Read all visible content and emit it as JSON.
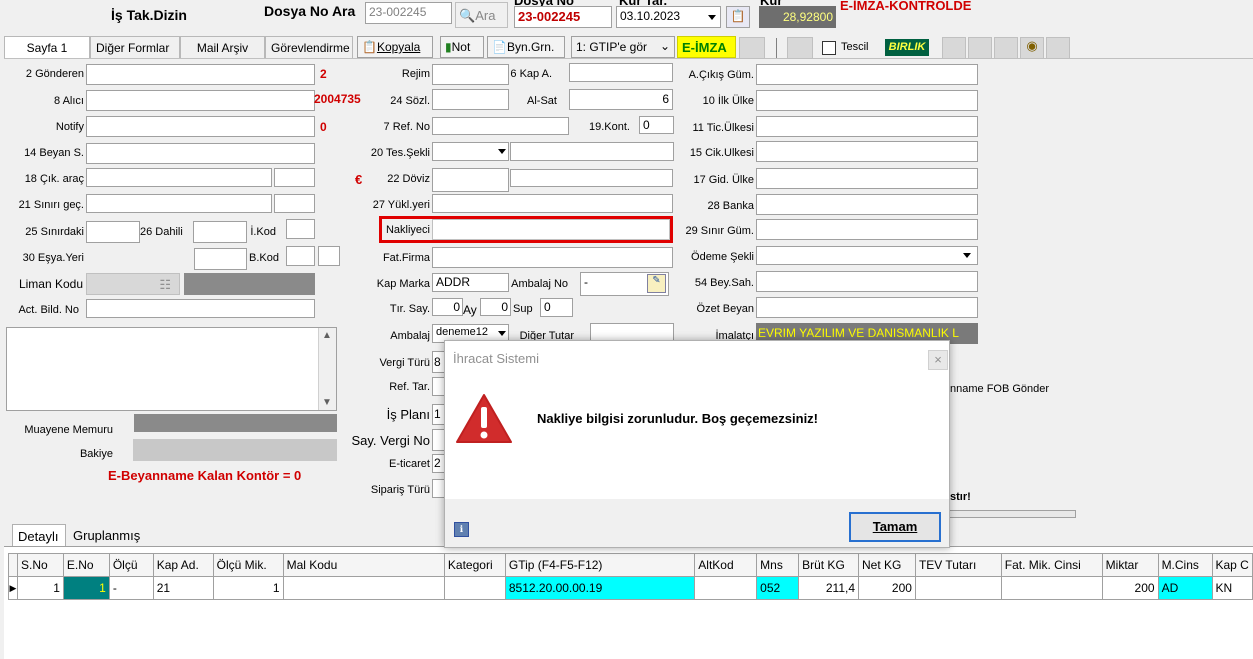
{
  "header": {
    "title": "İş Tak.Dizin",
    "dosya_no_label": "Dosya No Ara",
    "search_value": "23-002245",
    "ara_label": "Ara",
    "dosya_no_top": "Dosya No",
    "dosya_no_value": "23-002245",
    "kur_tar_label": "Kur Tar.",
    "date_value": "03.10.2023",
    "kur_label": "Kur",
    "kur_value": "28,92800",
    "status": "E-İMZA-KONTROLDE"
  },
  "tabs": [
    "Sayfa 1",
    "Diğer Formlar",
    "Mail Arşiv",
    "Görevlendirme"
  ],
  "toolbar": {
    "kopyala": "Kopyala",
    "not": "Not",
    "byn_grn": "Byn.Grn.",
    "gtip_select": "1: GTIP'e gör",
    "eimza": "E-İMZA",
    "tescil": "Tescil",
    "birlik": "BIRLIK"
  },
  "left": {
    "gonderen": "2 Gönderen",
    "gonderen_no": "2",
    "alici": "8 Alıcı",
    "alici_no": "2004735",
    "notify": "Notify",
    "notify_no": "0",
    "beyan": "14 Beyan S.",
    "cik_arac": "18 Çık. araç",
    "euro": "€",
    "sinir_gec": "21 Sınırı geç.",
    "sinirdaki": "25 Sınırdaki",
    "dahili": "26 Dahili",
    "ikod": "İ.Kod",
    "esya_yeri": "30 Eşya.Yeri",
    "bkod": "B.Kod",
    "liman_kodu": "Liman Kodu",
    "act_bild": "Act. Bild. No",
    "muayene": "Muayene Memuru",
    "bakiye": "Bakiye",
    "kontor": "E-Beyanname Kalan Kontör = 0"
  },
  "middle": {
    "rejim": "Rejim",
    "kap_a": "6 Kap A.",
    "sozl": "24 Sözl.",
    "alsat": "Al-Sat",
    "alsat_val": "6",
    "ref_no": "7 Ref. No",
    "kont": "19.Kont.",
    "kont_val": "0",
    "tes_sekli": "20 Tes.Şekli",
    "doviz": "22 Döviz",
    "yukl_yeri": "27 Yükl.yeri",
    "nakliyeci": "Nakliyeci",
    "fat_firma": "Fat.Firma",
    "kap_marka": "Kap Marka",
    "kap_marka_val": "ADDR",
    "ambalaj_no": "Ambalaj No",
    "ambalaj_no_val": "-",
    "tir_say": "Tır. Say.",
    "tir_val": "0",
    "ay": "Ay",
    "ay_val": "0",
    "sup": "Sup",
    "sup_val": "0",
    "ambalaj": "Ambalaj",
    "ambalaj_val": "deneme12",
    "diger_tutar": "Diğer Tutar",
    "vergi_turu": "Vergi Türü",
    "vergi_val": "8",
    "ref_tar": "Ref. Tar.",
    "is_plani": "İş Planı",
    "is_plani_val": "1",
    "say_vergi": "Say. Vergi No",
    "eticaret": "E-ticaret",
    "eticaret_val": "2",
    "siparis": "Sipariş Türü"
  },
  "right": {
    "a_cikis": "A.Çıkış Güm.",
    "ilk_ulke": "10 İlk Ülke",
    "tic_ulkesi": "11 Tic.Ülkesi",
    "cik_ulkesi": "15 Cik.Ulkesi",
    "gid_ulke": "17 Gid. Ülke",
    "banka": "28 Banka",
    "sinir_gum": "29 Sınır Güm.",
    "odeme": "Ödeme Şekli",
    "bey_sah": "54 Bey.Sah.",
    "ozet": "Özet Beyan",
    "imalatci": "İmalatçı",
    "imalatci_val": "EVRIM YAZILIM VE DANISMANLIK L",
    "fob": "nname FOB Gönder",
    "stir": "stır!"
  },
  "dialog": {
    "title": "İhracat Sistemi",
    "message": "Nakliye bilgisi zorunludur. Boş geçemezsiniz!",
    "ok": "Tamam",
    "close": "×"
  },
  "bottom_tabs": [
    "Detaylı",
    "Gruplanmış"
  ],
  "grid": {
    "columns": [
      "S.No",
      "E.No",
      "Ölçü",
      "Kap Ad.",
      "Ölçü Mik.",
      "Mal Kodu",
      "Kategori",
      "GTip (F4-F5-F12)",
      "AltKod",
      "Mns",
      "Brüt KG",
      "Net KG",
      "TEV Tutarı",
      "Fat. Mik. Cinsi",
      "Miktar",
      "M.Cins",
      "Kap C"
    ],
    "row": [
      "1",
      "1",
      "-",
      "21",
      "1",
      "",
      "",
      "8512.20.00.00.19",
      "",
      "052",
      "211,4",
      "200",
      "",
      "",
      "200",
      "AD",
      "KN"
    ]
  }
}
